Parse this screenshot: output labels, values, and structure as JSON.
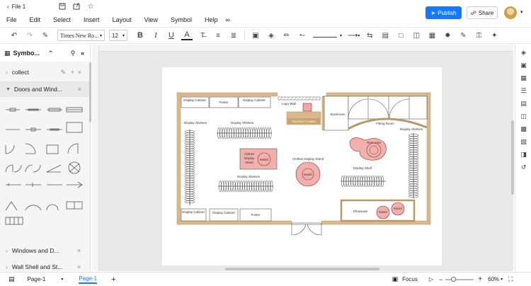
{
  "title": {
    "doc_name": "File 1"
  },
  "menu": [
    "File",
    "Edit",
    "Select",
    "Insert",
    "Layout",
    "View",
    "Symbol",
    "Help"
  ],
  "actions": {
    "publish": "Publish",
    "share": "Share"
  },
  "toolbar": {
    "font": "Times New Ro...",
    "size": "12"
  },
  "sidebar": {
    "title": "Symbo...",
    "items": [
      {
        "label": "collect"
      },
      {
        "label": "Doors and Wind..."
      },
      {
        "label": "Windows and D..."
      },
      {
        "label": "Wall Shell and St..."
      }
    ]
  },
  "floorplan": {
    "labels": {
      "display_cabinet": "Display Cabinet",
      "poster": "Poster",
      "logo_wall": "Logo Wall",
      "checkout": "Checkout Counter",
      "stockroom": "Stockroom",
      "fitting_room": "Fitting Room",
      "display_shelves": "Display Shelves",
      "display_shelf": "Display Shelf",
      "clothes_stand": "Clothes Display Stand",
      "model": "Model",
      "rest_area": "Rest Area",
      "showcase": "Showcase"
    }
  },
  "status": {
    "page_tab": "Page-1",
    "active_page": "Page-1",
    "focus": "Focus",
    "zoom": "60%"
  }
}
